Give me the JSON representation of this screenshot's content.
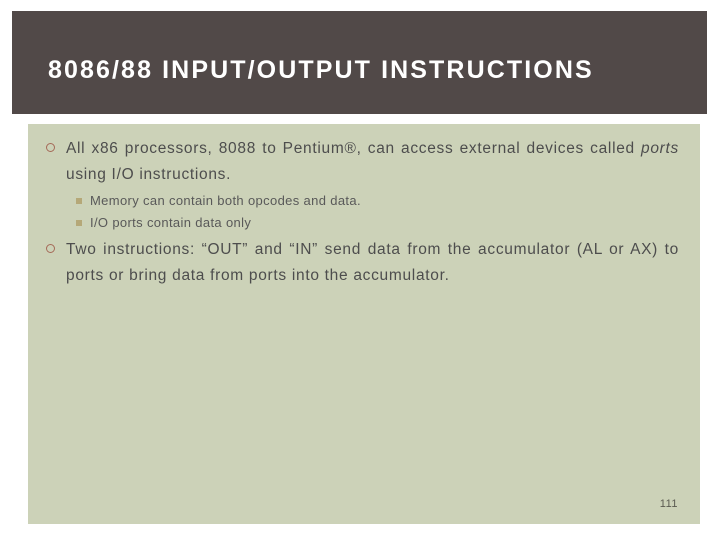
{
  "slide": {
    "title": "8086/88 INPUT/OUTPUT INSTRUCTIONS",
    "page_number": "111",
    "colors": {
      "title_band": "#514948",
      "title_text": "#ffffff",
      "content_panel": "#ccd2b8",
      "body_text": "#4d4d4d",
      "sub_text": "#595959",
      "ring_bullet": "#a56a58",
      "square_bullet": "#b5a878",
      "page_number": "#5a5a50",
      "slide_background": "#ffffff"
    },
    "bullets": [
      {
        "level": 1,
        "marker": "hollow-circle",
        "text_parts": [
          {
            "text": "All x86 processors, 8088 to Pentium®, can access external devices called ",
            "style": "normal"
          },
          {
            "text": "ports",
            "style": "italic"
          },
          {
            "text": " using I/O instructions.",
            "style": "normal"
          }
        ],
        "plain_text": "All x86 processors, 8088 to Pentium®, can access external devices called ports using I/O instructions."
      },
      {
        "level": 2,
        "marker": "filled-square",
        "plain_text": "Memory can contain both opcodes and data."
      },
      {
        "level": 2,
        "marker": "filled-square",
        "plain_text": "I/O ports contain data only"
      },
      {
        "level": 1,
        "marker": "hollow-circle",
        "plain_text": "Two instructions: “OUT” and “IN” send data from the accumulator (AL or AX) to ports or bring data from ports into the accumulator."
      }
    ],
    "bullet_text": {
      "b1_pre": "All x86 processors, 8088 to Pentium®, can access external devices called ",
      "b1_italic": "ports",
      "b1_post": " using I/O instructions.",
      "b2": "Memory can contain both opcodes and data.",
      "b3": "I/O ports contain data only",
      "b4": "Two instructions: “OUT” and “IN” send data from the accumulator (AL or AX) to ports or bring data from ports into the accumulator."
    }
  }
}
